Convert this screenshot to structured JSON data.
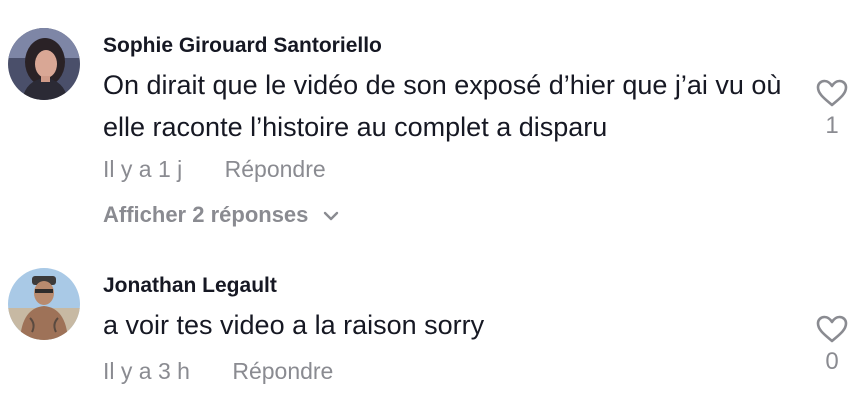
{
  "comments": [
    {
      "author": "Sophie Girouard Santoriello",
      "text": "On dirait que le vidéo de son exposé d’hier que j’ai vu où elle raconte l’histoire au complet a disparu",
      "time": "Il y a 1 j",
      "reply_label": "Répondre",
      "view_replies_label": "Afficher 2 réponses",
      "like_count": "1",
      "avatar_icon": "user-avatar"
    },
    {
      "author": "Jonathan Legault",
      "text": "a voir tes video a la raison sorry",
      "time": "Il y a 3 h",
      "reply_label": "Répondre",
      "like_count": "0",
      "avatar_icon": "user-avatar"
    }
  ],
  "colors": {
    "text": "#161823",
    "muted": "#8a8b91"
  }
}
